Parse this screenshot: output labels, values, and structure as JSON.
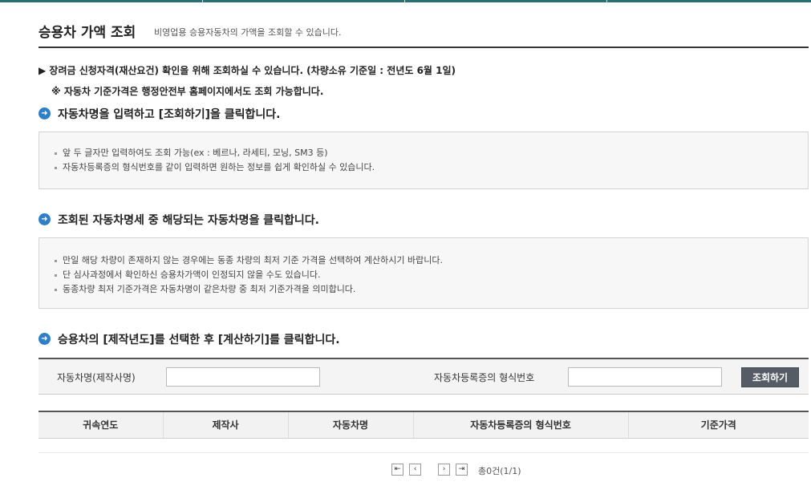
{
  "header": {
    "title": "승용차 가액 조회",
    "subtitle": "비영업용 승용자동차의 가액을 조회할 수 있습니다."
  },
  "notices": {
    "eligibility": "▶ 장려금 신청자격(재산요건) 확인을 위해 조회하실 수 있습니다. (차량소유 기준일 : 전년도 6월 1일)",
    "reference": "※ 자동차 기준가격은 행정안전부 홈페이지에서도 조회 가능합니다."
  },
  "steps": [
    {
      "title": "자동차명을 입력하고 [조회하기]을 클릭합니다.",
      "tips": [
        "앞 두 글자만 입력하여도 조회 가능(ex : 베르나, 라세티, 모닝, SM3 등)",
        "자동차등록증의 형식번호를 같이 입력하면 원하는 정보를 쉽게 확인하실 수 있습니다."
      ]
    },
    {
      "title": "조회된 자동차명세 중 해당되는 자동차명을 클릭합니다.",
      "tips": [
        "만일 해당 차량이 존재하지 않는 경우에는 동종 차량의 최저 기준 가격을 선택하여 계산하시기 바랍니다.",
        "단 심사과정에서 확인하신 승용차가액이 인정되지 않을 수도 있습니다.",
        "동종차량 최저 기준가격은 자동차명이 같은차량 중  최저 기준가격을 의미합니다."
      ]
    },
    {
      "title": "승용차의 [제작년도]를 선택한 후 [계산하기]를 클릭합니다."
    }
  ],
  "search": {
    "car_name_label": "자동차명(제작사명)",
    "car_name_value": "",
    "type_number_label": "자동차등록증의 형식번호",
    "type_number_value": "",
    "submit_label": "조회하기"
  },
  "table": {
    "columns": [
      "귀속연도",
      "제작사",
      "자동차명",
      "자동차등록증의 형식번호",
      "기준가격"
    ],
    "rows": []
  },
  "pager": {
    "first_icon": "first-page-icon",
    "prev_icon": "prev-page-icon",
    "next_icon": "next-page-icon",
    "last_icon": "last-page-icon",
    "total": "총0건(1/1)"
  },
  "colors": {
    "accent": "#2a6f73",
    "step_icon": "#2e7fc7",
    "button": "#555c66"
  }
}
